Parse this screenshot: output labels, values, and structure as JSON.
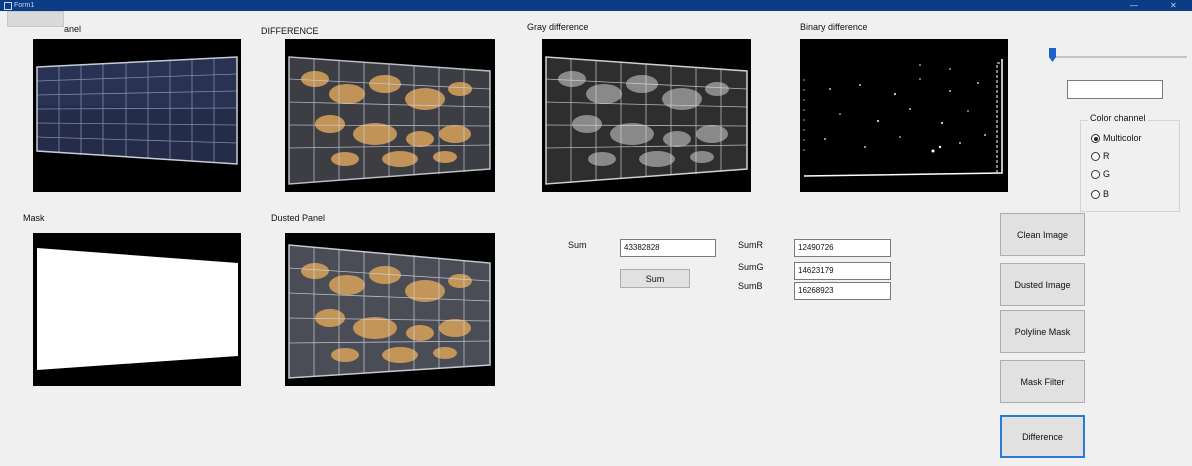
{
  "window": {
    "title": "Form1",
    "minimize_glyph": "—",
    "close_glyph": "✕"
  },
  "panels": {
    "clean_label": "anel",
    "difference_label": "DIFFERENCE",
    "gray_label": "Gray difference",
    "binary_label": "Binary difference",
    "mask_label": "Mask",
    "dusted_label": "Dusted Panel"
  },
  "sums": {
    "sum_label": "Sum",
    "sum_value": "43382828",
    "sum_button": "Sum",
    "sumr_label": "SumR",
    "sumr_value": "12490726",
    "sumg_label": "SumG",
    "sumg_value": "14623179",
    "sumb_label": "SumB",
    "sumb_value": "16268923"
  },
  "threshold": {
    "slider_value": 0.02,
    "text_value": ""
  },
  "color_channel": {
    "legend": "Color channel",
    "options": [
      "Multicolor",
      "R",
      "G",
      "B"
    ],
    "selected": "Multicolor"
  },
  "buttons": {
    "clean_image": "Clean Image",
    "dusted_image": "Dusted Image",
    "polyline_mask": "Polyline Mask",
    "mask_filter": "Mask Filter",
    "difference": "Difference"
  },
  "colors": {
    "title_bar": "#0a3d86",
    "slider_thumb": "#1e63c8",
    "focus_border": "#2b7ad6",
    "dust": "#d9a25a"
  },
  "icons": {
    "radio_selected": "radio-selected-icon",
    "radio_empty": "radio-empty-icon"
  }
}
